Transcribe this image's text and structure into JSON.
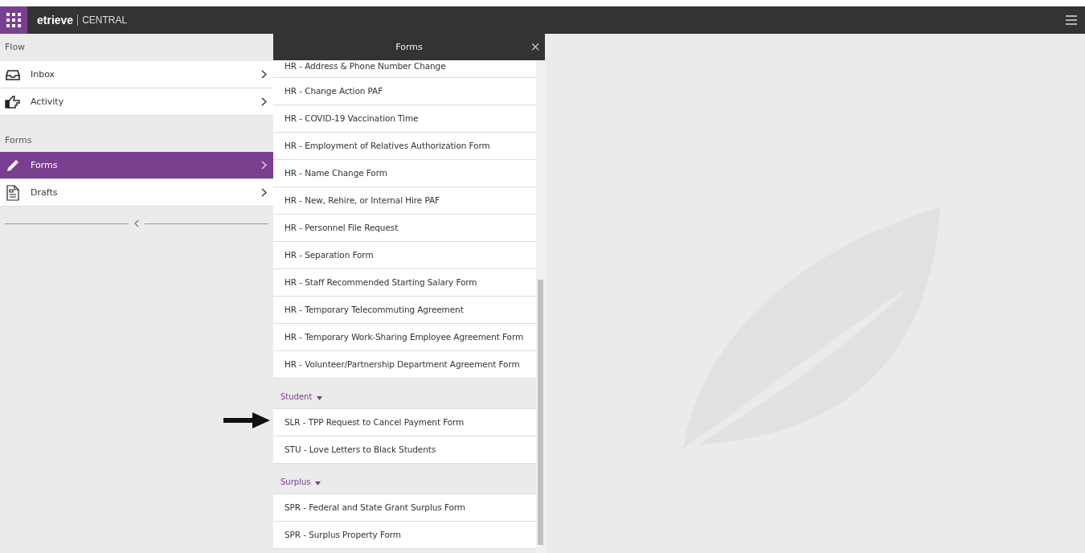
{
  "topbar": {
    "brand": "etrieve",
    "product": "CENTRAL"
  },
  "sidebar": {
    "sections": [
      {
        "heading": "Flow",
        "items": [
          {
            "label": "Inbox",
            "kind": "inbox",
            "selected": false
          },
          {
            "label": "Activity",
            "kind": "hand",
            "selected": false
          }
        ]
      },
      {
        "heading": "Forms",
        "items": [
          {
            "label": "Forms",
            "kind": "pencil",
            "selected": true
          },
          {
            "label": "Drafts",
            "kind": "document",
            "selected": false
          }
        ]
      }
    ]
  },
  "forms_panel": {
    "title": "Forms",
    "close": "×",
    "groups": [
      {
        "items": [
          "HR - Address & Phone Number Change",
          "HR - Change Action PAF",
          "HR - COVID-19 Vaccination Time",
          "HR - Employment of Relatives Authorization Form",
          "HR - Name Change Form",
          "HR - New, Rehire, or Internal Hire PAF",
          "HR - Personnel File Request",
          "HR - Separation Form",
          "HR - Staff Recommended Starting Salary Form",
          "HR - Temporary Telecommuting Agreement",
          "HR - Temporary Work-Sharing Employee Agreement Form",
          "HR - Volunteer/Partnership Department Agreement Form"
        ]
      },
      {
        "heading": "Student",
        "expanded": true,
        "items": [
          "SLR - TPP Request to Cancel Payment Form",
          "STU - Love Letters to Black Students"
        ]
      },
      {
        "heading": "Surplus",
        "expanded": true,
        "items": [
          "SPR - Federal and State Grant Surplus Form",
          "SPR - Surplus Property Form"
        ]
      }
    ]
  }
}
